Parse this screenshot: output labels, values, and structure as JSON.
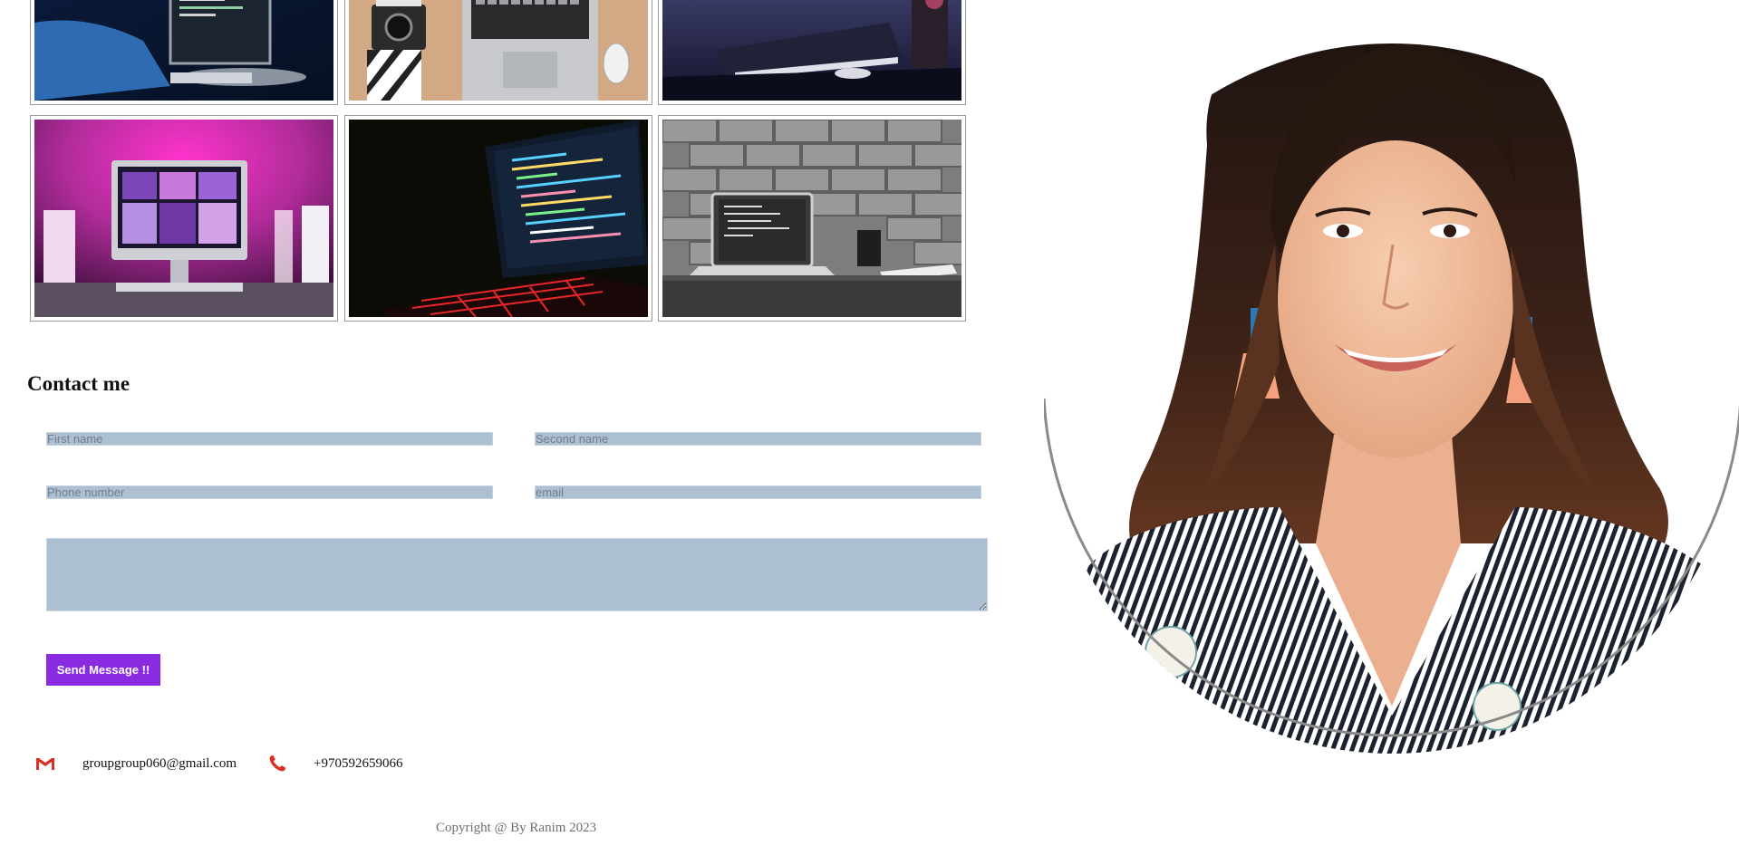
{
  "gallery": {
    "images": [
      {
        "alt": "person typing on computer"
      },
      {
        "alt": "camera and laptop on desk"
      },
      {
        "alt": "laptop on dark desk"
      },
      {
        "alt": "pink lit desktop setup"
      },
      {
        "alt": "laptop with code in dark"
      },
      {
        "alt": "laptop with code in black and white"
      }
    ]
  },
  "contact": {
    "title": "Contact me",
    "first_name_placeholder": "First name",
    "second_name_placeholder": "Second name",
    "phone_placeholder": "Phone number",
    "email_placeholder": "email",
    "message_placeholder": "",
    "send_label": "Send Message !!",
    "email_icon": "gmail-icon",
    "email_address": "groupgroup060@gmail.com",
    "phone_icon": "phone-icon",
    "phone_number": "+970592659066"
  },
  "footer": {
    "copyright": "Copyright @ By Ranim 2023"
  },
  "portrait": {
    "alt": "smiling woman portrait"
  },
  "colors": {
    "field_bg": "#adc0d1",
    "button_bg": "#8a2be2",
    "icon_red": "#d93025"
  }
}
